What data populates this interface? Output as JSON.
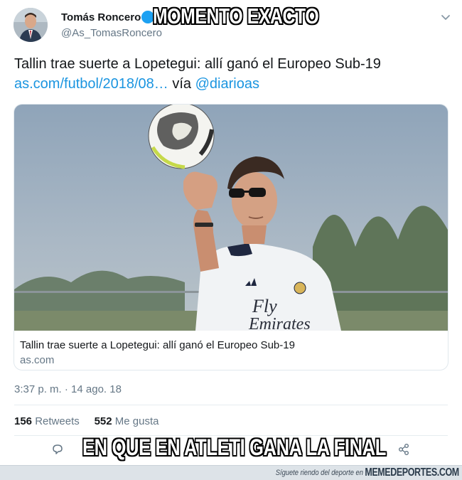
{
  "tweet": {
    "author_name": "Tomás Roncero",
    "author_handle": "@As_TomasRoncero",
    "text_line1": "Tallin trae suerte a Lopetegui: allí ganó el Europeo Sub-19",
    "link": "as.com/futbol/2018/08…",
    "via_label": "vía",
    "mention": "@diarioas",
    "timestamp": "3:37 p. m. · 14 ago. 18",
    "retweets_count": "156",
    "retweets_label": "Retweets",
    "likes_count": "552",
    "likes_label": "Me gusta"
  },
  "card": {
    "title": "Tallin trae suerte a Lopetegui: allí ganó el Europeo Sub-19",
    "domain": "as.com",
    "shirt_sponsor": "Fly Emirates"
  },
  "meme": {
    "top_caption": "MOMENTO EXACTO",
    "bottom_caption": "EN QUE EN ATLETI GANA LA FINAL"
  },
  "footer": {
    "tagline": "Síguete riendo del deporte en",
    "brand": "MEMEDEPORTES.COM"
  },
  "icons": {
    "verified": "verified-badge-icon",
    "caret": "chevron-down-icon",
    "reply": "reply-icon",
    "share": "share-icon"
  },
  "colors": {
    "link": "#1b95e0",
    "verified": "#1da1f2",
    "muted": "#657786"
  }
}
